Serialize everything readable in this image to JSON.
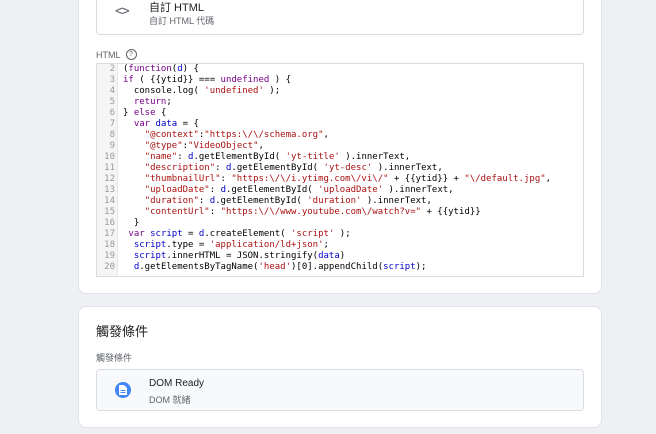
{
  "tag_type": {
    "name": "自訂 HTML",
    "subtitle": "自訂 HTML 代碼",
    "icon": "code-brackets-icon"
  },
  "html_field": {
    "label": "HTML",
    "help_icon": "help-circle-icon"
  },
  "code": {
    "lines": [
      {
        "n": "2",
        "text": "(function(d) {"
      },
      {
        "n": "3",
        "text": "if ( {{ytid}} === undefined ) {"
      },
      {
        "n": "4",
        "text": "  console.log( 'undefined' );"
      },
      {
        "n": "5",
        "text": "  return;"
      },
      {
        "n": "6",
        "text": "} else {"
      },
      {
        "n": "7",
        "text": "  var data = {"
      },
      {
        "n": "8",
        "text": "    \"@context\":\"https:\\/\\/schema.org\","
      },
      {
        "n": "9",
        "text": "    \"@type\":\"VideoObject\","
      },
      {
        "n": "10",
        "text": "    \"name\": d.getElementById( 'yt-title' ).innerText,"
      },
      {
        "n": "11",
        "text": "    \"description\": d.getElementById( 'yt-desc' ).innerText,"
      },
      {
        "n": "12",
        "text": "    \"thumbnailUrl\": \"https:\\/\\/i.ytimg.com\\/vi\\/\" + {{ytid}} + \"\\/default.jpg\","
      },
      {
        "n": "13",
        "text": "    \"uploadDate\": d.getElementById( 'uploadDate' ).innerText,"
      },
      {
        "n": "14",
        "text": "    \"duration\": d.getElementById( 'duration' ).innerText,"
      },
      {
        "n": "15",
        "text": "    \"contentUrl\": \"https:\\/\\/www.youtube.com\\/watch?v=\" + {{ytid}}"
      },
      {
        "n": "16",
        "text": "  }"
      },
      {
        "n": "17",
        "text": " var script = d.createElement( 'script' );"
      },
      {
        "n": "18",
        "text": "  script.type = 'application/ld+json';"
      },
      {
        "n": "19",
        "text": "  script.innerHTML = JSON.stringify(data)"
      },
      {
        "n": "20",
        "text": "  d.getElementsByTagName('head')[0].appendChild(script);"
      }
    ]
  },
  "trigger": {
    "title": "觸發條件",
    "section_label": "觸發條件",
    "item": {
      "name": "DOM Ready",
      "subtitle": "DOM 就緒",
      "icon": "document-icon",
      "icon_color": "#4285f4"
    }
  }
}
